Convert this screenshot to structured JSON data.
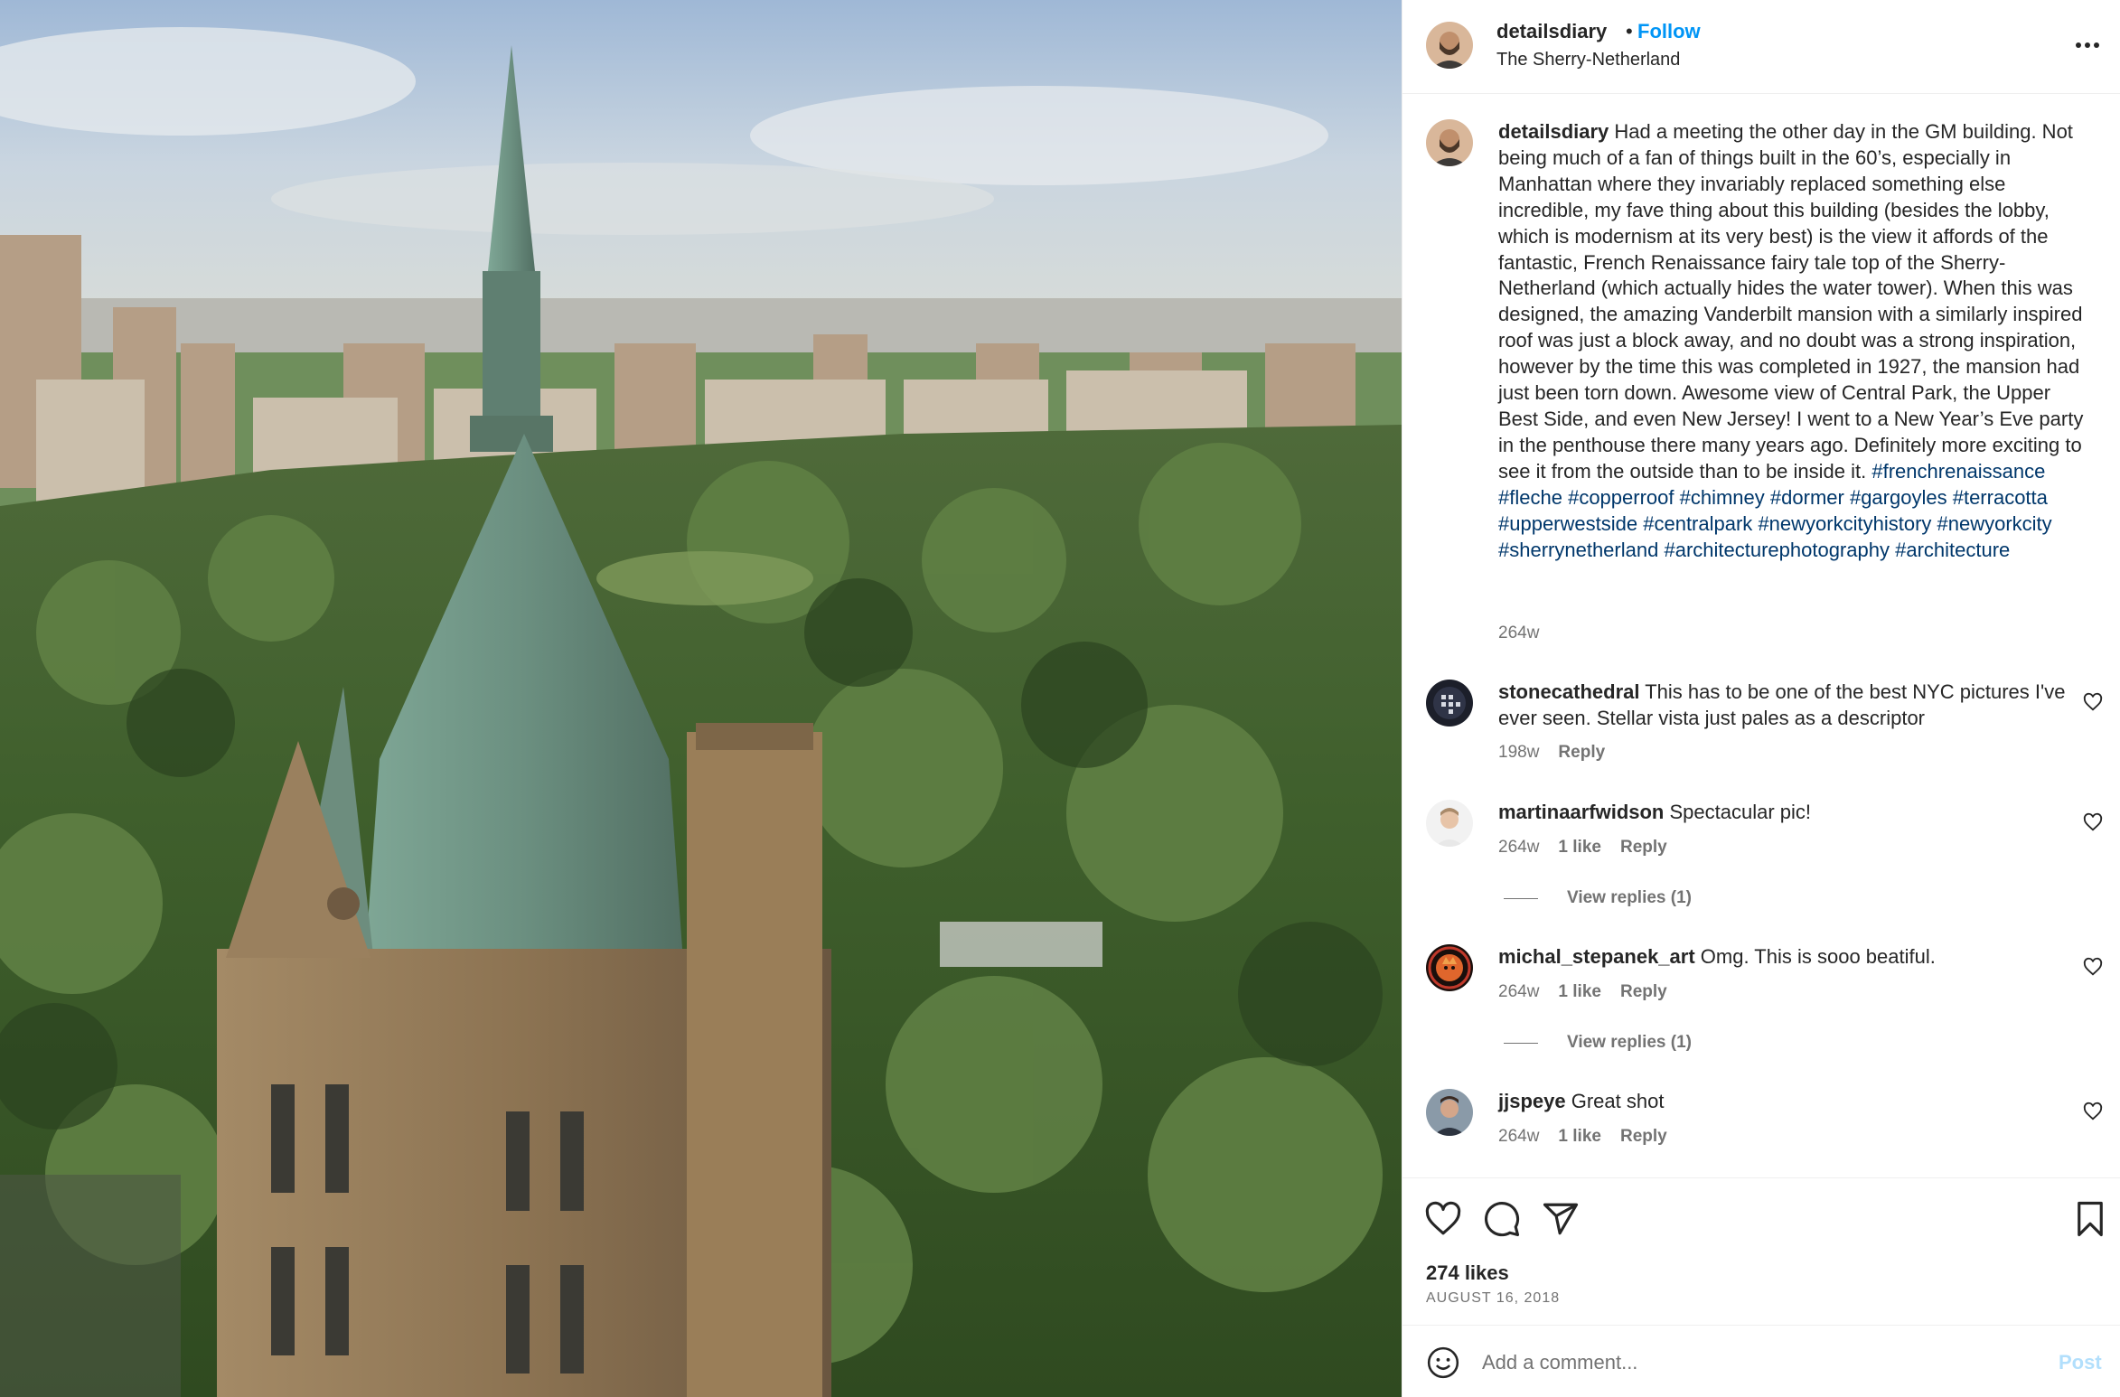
{
  "header": {
    "username": "detailsdiary",
    "separator": "•",
    "follow_label": "Follow",
    "location": "The Sherry-Netherland",
    "more_icon": "more-horizontal-icon"
  },
  "caption": {
    "username": "detailsdiary",
    "text": "Had a meeting the other day in the GM building. Not being much of a fan of things built in the 60’s, especially in Manhattan where they invariably replaced something else incredible, my fave thing about this building (besides the lobby, which is modernism at its very best) is the view it affords of the fantastic, French Renaissance fairy tale top of the Sherry-Netherland (which actually hides the water tower). When this was designed, the amazing Vanderbilt mansion with a similarly inspired roof was just a block away, and no doubt was a strong inspiration, however by the time this was completed in 1927, the mansion had just been torn down. Awesome view of Central Park, the Upper Best Side, and even New Jersey! I went to a New Year’s Eve party in the penthouse there many years ago. Definitely more exciting to see it from the outside than to be inside it.",
    "hashtags": [
      "#frenchrenaissance",
      "#fleche",
      "#copperroof",
      "#chimney",
      "#dormer",
      "#gargoyles",
      "#terracotta",
      "#upperwestside",
      "#centralpark",
      "#newyorkcityhistory",
      "#newyorkcity",
      "#sherrynetherland",
      "#architecturephotography",
      "#architecture"
    ],
    "time": "264w"
  },
  "comments": [
    {
      "username": "stonecathedral",
      "text": "This has to be one of the best NYC pictures I've ever seen. Stellar vista just pales as a descriptor",
      "time": "198w",
      "likes": "",
      "reply_label": "Reply",
      "view_replies": ""
    },
    {
      "username": "martinaarfwidson",
      "text": "Spectacular pic!",
      "time": "264w",
      "likes": "1 like",
      "reply_label": "Reply",
      "view_replies": "View replies (1)"
    },
    {
      "username": "michal_stepanek_art",
      "text": "Omg. This is sooo beatiful.",
      "time": "264w",
      "likes": "1 like",
      "reply_label": "Reply",
      "view_replies": "View replies (1)"
    },
    {
      "username": "jjspeye",
      "text": "Great shot",
      "time": "264w",
      "likes": "1 like",
      "reply_label": "Reply",
      "view_replies": ""
    }
  ],
  "actions": {
    "like_icon": "heart-icon",
    "comment_icon": "comment-icon",
    "share_icon": "send-icon",
    "save_icon": "bookmark-icon",
    "likes_count": "274 likes",
    "date": "AUGUST 16, 2018"
  },
  "add_comment": {
    "emoji_icon": "emoji-icon",
    "placeholder": "Add a comment...",
    "post_label": "Post"
  },
  "colors": {
    "accent": "#0095f6",
    "hashtag": "#00376b",
    "secondary_text": "#737373",
    "post_disabled": "#b2dffc"
  }
}
